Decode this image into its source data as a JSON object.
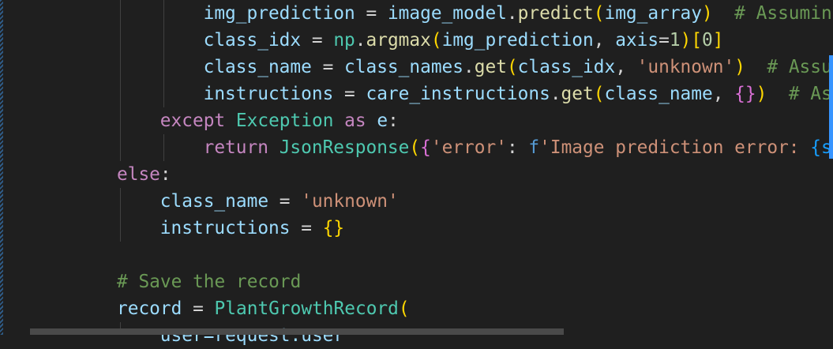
{
  "editor": {
    "language": "python",
    "lines": [
      {
        "indent": 4,
        "tokens": [
          {
            "t": "img_prediction",
            "c": "var"
          },
          {
            "t": " = ",
            "c": "op"
          },
          {
            "t": "image_model",
            "c": "var"
          },
          {
            "t": ".",
            "c": "op"
          },
          {
            "t": "predict",
            "c": "fn"
          },
          {
            "t": "(",
            "c": "b1"
          },
          {
            "t": "img_array",
            "c": "var"
          },
          {
            "t": ")",
            "c": "b1"
          },
          {
            "t": "  # Assumin",
            "c": "cmt"
          }
        ]
      },
      {
        "indent": 4,
        "tokens": [
          {
            "t": "class_idx",
            "c": "var"
          },
          {
            "t": " = ",
            "c": "op"
          },
          {
            "t": "np",
            "c": "cls"
          },
          {
            "t": ".",
            "c": "op"
          },
          {
            "t": "argmax",
            "c": "fn"
          },
          {
            "t": "(",
            "c": "b1"
          },
          {
            "t": "img_prediction",
            "c": "var"
          },
          {
            "t": ", ",
            "c": "op"
          },
          {
            "t": "axis",
            "c": "var"
          },
          {
            "t": "=",
            "c": "op"
          },
          {
            "t": "1",
            "c": "num"
          },
          {
            "t": ")",
            "c": "b1"
          },
          {
            "t": "[",
            "c": "b1"
          },
          {
            "t": "0",
            "c": "num"
          },
          {
            "t": "]",
            "c": "b1"
          }
        ]
      },
      {
        "indent": 4,
        "tokens": [
          {
            "t": "class_name",
            "c": "var"
          },
          {
            "t": " = ",
            "c": "op"
          },
          {
            "t": "class_names",
            "c": "var"
          },
          {
            "t": ".",
            "c": "op"
          },
          {
            "t": "get",
            "c": "fn"
          },
          {
            "t": "(",
            "c": "b1"
          },
          {
            "t": "class_idx",
            "c": "var"
          },
          {
            "t": ", ",
            "c": "op"
          },
          {
            "t": "'unknown'",
            "c": "str"
          },
          {
            "t": ")",
            "c": "b1"
          },
          {
            "t": "  # Assu",
            "c": "cmt"
          }
        ]
      },
      {
        "indent": 4,
        "tokens": [
          {
            "t": "instructions",
            "c": "var"
          },
          {
            "t": " = ",
            "c": "op"
          },
          {
            "t": "care_instructions",
            "c": "var"
          },
          {
            "t": ".",
            "c": "op"
          },
          {
            "t": "get",
            "c": "fn"
          },
          {
            "t": "(",
            "c": "b1"
          },
          {
            "t": "class_name",
            "c": "var"
          },
          {
            "t": ", ",
            "c": "op"
          },
          {
            "t": "{",
            "c": "b2"
          },
          {
            "t": "}",
            "c": "b2"
          },
          {
            "t": ")",
            "c": "b1"
          },
          {
            "t": "  # As",
            "c": "cmt"
          }
        ]
      },
      {
        "indent": 2,
        "tokens": [
          {
            "t": "except",
            "c": "kw"
          },
          {
            "t": " ",
            "c": "op"
          },
          {
            "t": "Exception",
            "c": "cls"
          },
          {
            "t": " ",
            "c": "op"
          },
          {
            "t": "as",
            "c": "kw"
          },
          {
            "t": " ",
            "c": "op"
          },
          {
            "t": "e",
            "c": "var"
          },
          {
            "t": ":",
            "c": "op"
          }
        ]
      },
      {
        "indent": 4,
        "tokens": [
          {
            "t": "return",
            "c": "kw"
          },
          {
            "t": " ",
            "c": "op"
          },
          {
            "t": "JsonResponse",
            "c": "cls"
          },
          {
            "t": "(",
            "c": "b1"
          },
          {
            "t": "{",
            "c": "b2"
          },
          {
            "t": "'error'",
            "c": "str"
          },
          {
            "t": ": ",
            "c": "op"
          },
          {
            "t": "f",
            "c": "kw2"
          },
          {
            "t": "'Image prediction error: ",
            "c": "str"
          },
          {
            "t": "{s",
            "c": "b3"
          }
        ]
      },
      {
        "indent": 0,
        "tokens": [
          {
            "t": "else",
            "c": "kw"
          },
          {
            "t": ":",
            "c": "op"
          }
        ]
      },
      {
        "indent": 2,
        "tokens": [
          {
            "t": "class_name",
            "c": "var"
          },
          {
            "t": " = ",
            "c": "op"
          },
          {
            "t": "'unknown'",
            "c": "str"
          }
        ]
      },
      {
        "indent": 2,
        "tokens": [
          {
            "t": "instructions",
            "c": "var"
          },
          {
            "t": " = ",
            "c": "op"
          },
          {
            "t": "{",
            "c": "b1"
          },
          {
            "t": "}",
            "c": "b1"
          }
        ]
      },
      {
        "indent": 0,
        "tokens": []
      },
      {
        "indent": 0,
        "tokens": [
          {
            "t": "# Save the record",
            "c": "cmt"
          }
        ]
      },
      {
        "indent": 0,
        "tokens": [
          {
            "t": "record",
            "c": "var"
          },
          {
            "t": " = ",
            "c": "op"
          },
          {
            "t": "PlantGrowthRecord",
            "c": "cls"
          },
          {
            "t": "(",
            "c": "b1"
          }
        ]
      },
      {
        "indent": 2,
        "tokens": [
          {
            "t": "user=request.user",
            "c": "var"
          }
        ]
      }
    ]
  }
}
